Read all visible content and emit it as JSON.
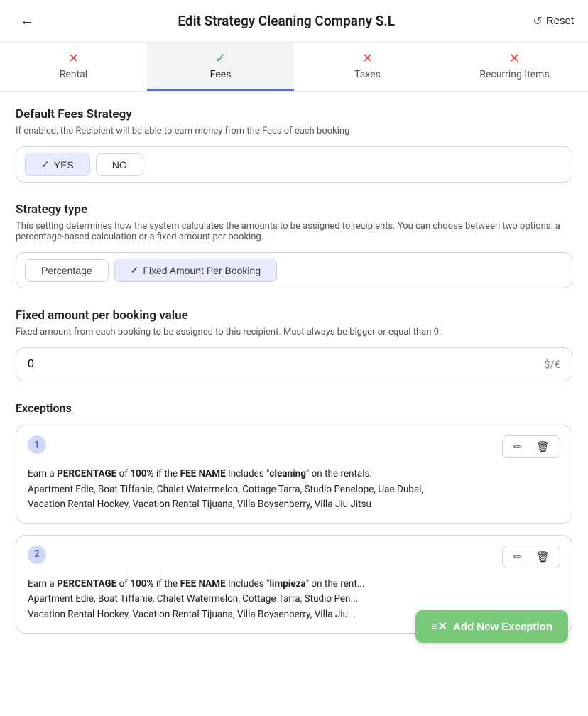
{
  "header": {
    "title": "Edit Strategy Cleaning Company S.L",
    "back_label": "←",
    "reset_label": "Reset",
    "reset_icon": "↺"
  },
  "tabs": [
    {
      "id": "rental",
      "label": "Rental",
      "icon": "✕",
      "icon_type": "red",
      "active": false
    },
    {
      "id": "fees",
      "label": "Fees",
      "icon": "✓",
      "icon_type": "green",
      "active": true
    },
    {
      "id": "taxes",
      "label": "Taxes",
      "icon": "✕",
      "icon_type": "red",
      "active": false
    },
    {
      "id": "recurring",
      "label": "Recurring Items",
      "icon": "✕",
      "icon_type": "red",
      "active": false
    }
  ],
  "default_fees": {
    "title": "Default Fees Strategy",
    "description": "If enabled, the Recipient will be able to earn money from the Fees of each booking",
    "options": [
      {
        "id": "yes",
        "label": "YES",
        "selected": true
      },
      {
        "id": "no",
        "label": "NO",
        "selected": false
      }
    ]
  },
  "strategy_type": {
    "title": "Strategy type",
    "description": "This setting determines how the system calculates the amounts to be assigned to recipients. You can choose between two options: a percentage-based calculation or a fixed amount per booking.",
    "options": [
      {
        "id": "percentage",
        "label": "Percentage",
        "selected": false
      },
      {
        "id": "fixed",
        "label": "Fixed Amount Per Booking",
        "selected": true
      }
    ]
  },
  "fixed_amount": {
    "title": "Fixed amount per booking value",
    "description": "Fixed amount from each booking to be assigned to this recipient. Must always be bigger or equal than 0.",
    "value": "0",
    "suffix": "$/€"
  },
  "exceptions": {
    "title": "Exceptions",
    "items": [
      {
        "number": "1",
        "text_parts": [
          {
            "type": "normal",
            "text": "Earn a "
          },
          {
            "type": "bold",
            "text": "PERCENTAGE"
          },
          {
            "type": "normal",
            "text": " of "
          },
          {
            "type": "bold",
            "text": "100%"
          },
          {
            "type": "normal",
            "text": " if the "
          },
          {
            "type": "bold",
            "text": "FEE NAME"
          },
          {
            "type": "normal",
            "text": " Includes \""
          },
          {
            "type": "bold",
            "text": "cleaning"
          },
          {
            "type": "normal",
            "text": "\" on the rentals:\nApartment Edie, Boat Tiffanie, Chalet Watermelon, Cottage Tarra, Studio Penelope, Uae Dubai,\nVacation Rental Hockey, Vacation Rental Tijuana, Villa Boysenberry, Villa Jiu Jitsu"
          }
        ]
      },
      {
        "number": "2",
        "text_parts": [
          {
            "type": "normal",
            "text": "Earn a "
          },
          {
            "type": "bold",
            "text": "PERCENTAGE"
          },
          {
            "type": "normal",
            "text": " of "
          },
          {
            "type": "bold",
            "text": "100%"
          },
          {
            "type": "normal",
            "text": " if the "
          },
          {
            "type": "bold",
            "text": "FEE NAME"
          },
          {
            "type": "normal",
            "text": " Includes \""
          },
          {
            "type": "bold",
            "text": "limpieza"
          },
          {
            "type": "normal",
            "text": "\" on the rent...\nApartment Edie, Boat Tiffanie, Chalet Watermelon, Cottage Tarra, Studio Pen...\nVacation Rental Hockey, Vacation Rental Tijuana, Villa Boysenberry, Villa Jiu..."
          }
        ]
      }
    ]
  },
  "add_exception_btn": {
    "label": "Add New Exception",
    "icon": "≡×"
  }
}
